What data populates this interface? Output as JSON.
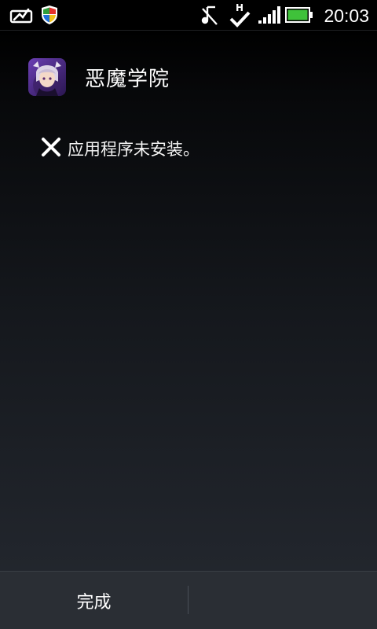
{
  "status_bar": {
    "time": "20:03",
    "icons": [
      "image-icon",
      "shield-icon",
      "music-off-icon",
      "hspa-sync-icon",
      "signal-icon",
      "battery-icon"
    ],
    "battery_color": "#3fc23a"
  },
  "app": {
    "name": "恶魔学院",
    "icon": "app-icon"
  },
  "result": {
    "icon": "close-icon",
    "message": "应用程序未安装。"
  },
  "footer": {
    "done_label": "完成"
  }
}
